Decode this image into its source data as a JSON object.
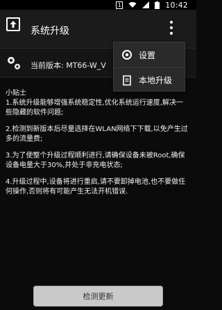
{
  "status_bar": {
    "sim_badge": "1",
    "time": "10:42",
    "icons": [
      "wifi-icon",
      "signal-icon",
      "battery-icon"
    ]
  },
  "header": {
    "title": "系统升级",
    "app_icon": "upload-icon",
    "overflow_icon": "more-vert-icon"
  },
  "version_row": {
    "icon": "gear-icon",
    "text": "当前版本: MT66-W_V"
  },
  "menu": {
    "items": [
      {
        "label": "设置",
        "icon": "gear-icon"
      },
      {
        "label": "本地升级",
        "icon": "document-icon"
      }
    ]
  },
  "tips": {
    "title": "小贴士",
    "paragraphs": [
      "1.系统升级能够增强系统稳定性,优化系统运行速度,解决一些隐藏的软件问题;",
      "2.检测到新版本后尽量选择在WLAN网络下下载,以免产生过多的流量费;",
      "3.为了使整个升级过程顺利进行,请确保设备未被Root,确保设备电量大于30%,并处于非充电状态;",
      "4.升级过程中,设备将进行重启,请不要卸掉电池,也不要做任何操作,否则将有可能产生无法开机错误."
    ]
  },
  "button": {
    "label": "检测更新"
  },
  "colors": {
    "background": "#0b0b0b",
    "actionbar": "#1b1b1b",
    "menu_bg": "#2a2a2a",
    "button_bg": "#c9c9c9"
  }
}
